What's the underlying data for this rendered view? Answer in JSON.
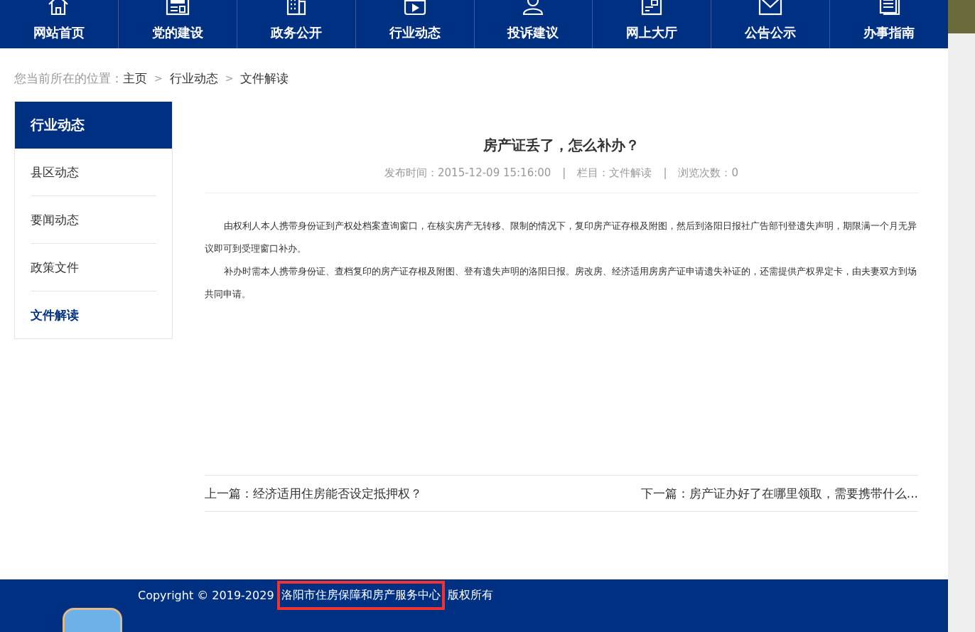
{
  "nav": [
    {
      "label": "网站首页"
    },
    {
      "label": "党的建设"
    },
    {
      "label": "政务公开"
    },
    {
      "label": "行业动态"
    },
    {
      "label": "投诉建议"
    },
    {
      "label": "网上大厅"
    },
    {
      "label": "公告公示"
    },
    {
      "label": "办事指南"
    }
  ],
  "breadcrumb": {
    "prefix": "您当前所在的位置：",
    "items": [
      "主页",
      "行业动态",
      "文件解读"
    ],
    "separator": ">"
  },
  "sidebar": {
    "title": "行业动态",
    "items": [
      {
        "label": "县区动态",
        "selected": false
      },
      {
        "label": "要闻动态",
        "selected": false
      },
      {
        "label": "政策文件",
        "selected": false
      },
      {
        "label": "文件解读",
        "selected": true
      }
    ]
  },
  "article": {
    "title": "房产证丢了，怎么补办？",
    "meta": [
      "发布时间：2015-12-09 15:16:00",
      "栏目：文件解读",
      "浏览次数：0"
    ],
    "meta_separator": "|",
    "paragraphs": [
      "由权利人本人携带身份证到产权处档案查询窗口，在核实房产无转移、限制的情况下，复印房产证存根及附图，然后到洛阳日报社广告部刊登遗失声明，期限满一个月无异议即可到受理窗口补办。",
      "补办时需本人携带身份证、查档复印的房产证存根及附图、登有遗失声明的洛阳日报。房改房、经济适用房房产证申请遗失补证的，还需提供产权界定卡，由夫妻双方到场共同申请。"
    ],
    "prev": "上一篇：经济适用住房能否设定抵押权？",
    "next": "下一篇：房产证办好了在哪里领取，需要携带什么..."
  },
  "footer": {
    "copyright": "Copyright © 2019-2029",
    "organization": "洛阳市住房保障和房产服务中心",
    "rights": "版权所有"
  }
}
